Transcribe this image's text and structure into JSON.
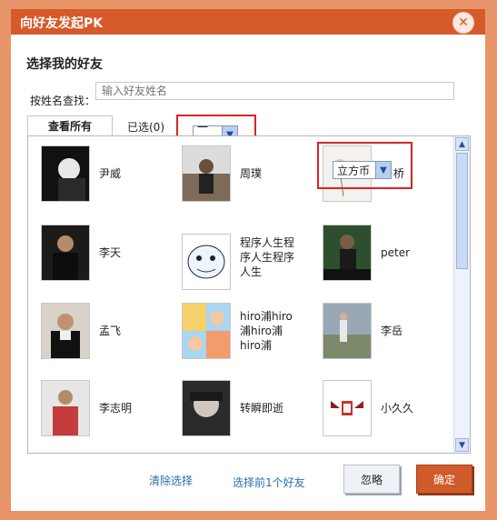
{
  "dialog": {
    "title": "向好友发起PK",
    "close_symbol": "✕",
    "heading": "选择我的好友",
    "search_label": "按姓名查找：",
    "search_placeholder": "输入好友姓名"
  },
  "tabs": {
    "all": "查看所有",
    "selected": "已选(0)"
  },
  "filters": {
    "duration_value": "一天",
    "currency_value": "立方币"
  },
  "friends": [
    {
      "name": "尹威"
    },
    {
      "name": "周璞"
    },
    {
      "name": "桥"
    },
    {
      "name": "李天"
    },
    {
      "name": "程序人生程序人生程序人生"
    },
    {
      "name": "peter"
    },
    {
      "name": "孟飞"
    },
    {
      "name": "hiro浦hiro浦hiro浦hiro浦"
    },
    {
      "name": "李岳"
    },
    {
      "name": "李志明"
    },
    {
      "name": "转瞬即逝"
    },
    {
      "name": "小久久"
    }
  ],
  "footer": {
    "clear": "清除选择",
    "select_first": "选择前1个好友",
    "ignore": "忽略",
    "confirm": "确定"
  },
  "colors": {
    "frame": "#e8956a",
    "titlebar": "#d65a2a",
    "link": "#2a6cae",
    "highlight": "#d22222"
  }
}
